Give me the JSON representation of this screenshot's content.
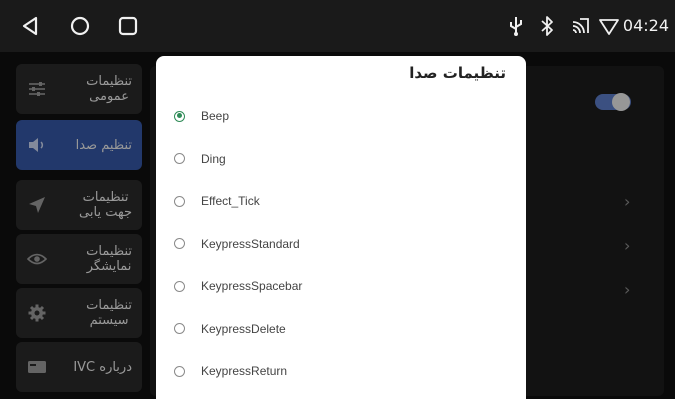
{
  "status_bar": {
    "nav_icons": [
      "back-triangle-icon",
      "home-circle-icon",
      "recents-square-icon"
    ],
    "status_icons": [
      "usb-icon",
      "bluetooth-icon",
      "cast-icon",
      "wifi-icon"
    ],
    "time": "04:24"
  },
  "sidebar": {
    "items": [
      {
        "label": "تنظیمات\nعمومی",
        "icon": "sliders-icon"
      },
      {
        "label": "تنظیم صدا",
        "icon": "speaker-icon",
        "active": true
      },
      {
        "label": "تنظیمات\nجهت یابی",
        "icon": "navigation-arrow-icon"
      },
      {
        "label": "تنظیمات\nنمایشگر",
        "icon": "eye-icon"
      },
      {
        "label": "تنظیمات\nسیستم",
        "icon": "gear-icon"
      },
      {
        "label": "درباره IVC",
        "icon": "card-icon"
      }
    ]
  },
  "dialog": {
    "title": "تنظیمات صدا",
    "selected": "Beep",
    "options": [
      "Beep",
      "Ding",
      "Effect_Tick",
      "KeypressStandard",
      "KeypressSpacebar",
      "KeypressDelete",
      "KeypressReturn"
    ]
  },
  "colors": {
    "accent": "#3557a5",
    "radio_selected": "#2e8b57"
  }
}
